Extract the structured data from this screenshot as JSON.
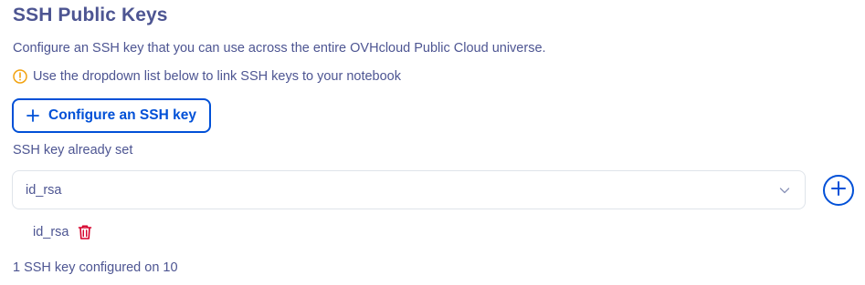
{
  "section": {
    "title": "SSH Public Keys",
    "description": "Configure an SSH key that you can use across the entire OVHcloud Public Cloud universe.",
    "warning": "Use the dropdown list below to link SSH keys to your notebook",
    "warning_icon": "warning-circle-icon"
  },
  "configure_button": {
    "label": "Configure an SSH key",
    "icon": "plus-icon"
  },
  "ssh_select": {
    "label": "SSH key already set",
    "selected_value": "id_rsa",
    "icon": "chevron-down-icon"
  },
  "add_button": {
    "icon": "plus-circle-icon"
  },
  "keys": [
    {
      "name": "id_rsa",
      "delete_icon": "trash-icon"
    }
  ],
  "footer": {
    "count_text": "1 SSH key configured on 10"
  },
  "colors": {
    "primary": "#0050d7",
    "text": "#4d5592",
    "warning": "#f2a20f",
    "danger": "#d6002b",
    "border": "#dfe4ea"
  }
}
